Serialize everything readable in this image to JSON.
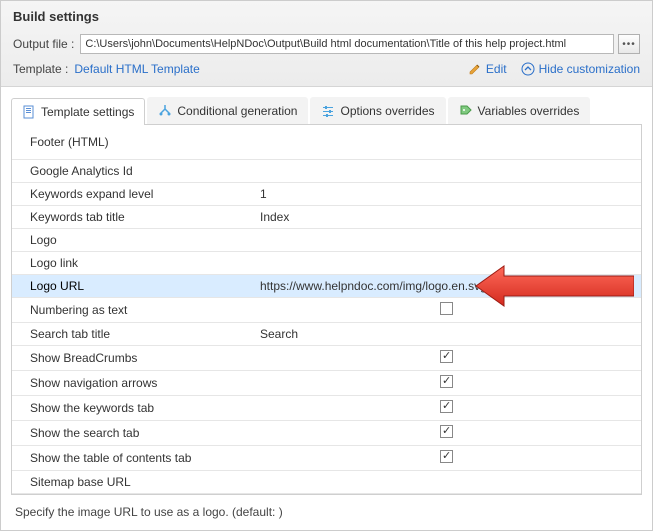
{
  "header": {
    "title": "Build settings",
    "output_label": "Output file :",
    "output_path": "C:\\Users\\john\\Documents\\HelpNDoc\\Output\\Build html documentation\\Title of this help project.html",
    "template_label": "Template :",
    "template_name": "Default HTML Template",
    "edit_label": "Edit",
    "hide_label": "Hide customization"
  },
  "tabs": [
    {
      "label": "Template settings"
    },
    {
      "label": "Conditional generation"
    },
    {
      "label": "Options overrides"
    },
    {
      "label": "Variables overrides"
    }
  ],
  "rows": {
    "footer_html": "Footer (HTML)",
    "google_analytics": "Google Analytics Id",
    "keywords_expand": "Keywords expand level",
    "keywords_expand_val": "1",
    "keywords_tab_title": "Keywords tab title",
    "keywords_tab_title_val": "Index",
    "logo": "Logo",
    "logo_link": "Logo link",
    "logo_url": "Logo URL",
    "logo_url_val": "https://www.helpndoc.com/img/logo.en.svg",
    "numbering": "Numbering as text",
    "search_tab_title": "Search tab title",
    "search_tab_title_val": "Search",
    "show_breadcrumbs": "Show BreadCrumbs",
    "show_nav": "Show navigation arrows",
    "show_keywords_tab": "Show the keywords tab",
    "show_search_tab": "Show the search tab",
    "show_toc_tab": "Show the table of contents tab",
    "sitemap": "Sitemap base URL"
  },
  "help_text": "Specify the image URL to use as a logo. (default: )"
}
